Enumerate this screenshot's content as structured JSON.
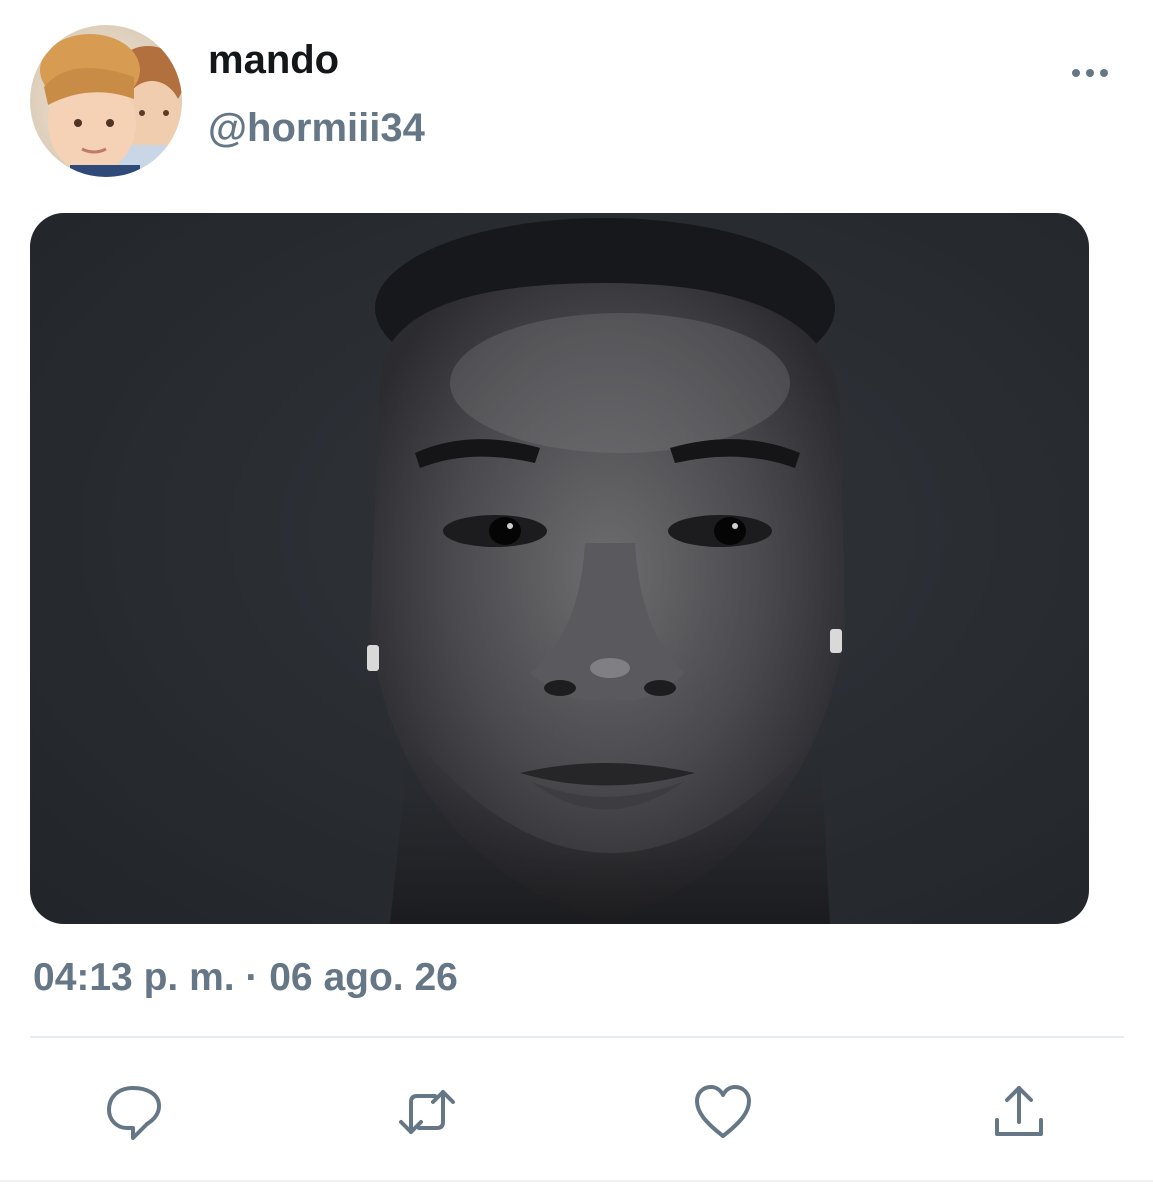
{
  "user": {
    "display_name": "mando",
    "handle": "@hormiii34"
  },
  "tweet": {
    "timestamp": "04:13 p. m. · 06 ago. 26"
  },
  "icons": {
    "more": "more-horizontal-icon",
    "reply": "reply-icon",
    "retweet": "retweet-icon",
    "like": "heart-icon",
    "share": "share-icon"
  },
  "colors": {
    "primary_text": "#14171a",
    "secondary_text": "#657786",
    "divider": "#e6ecf0"
  }
}
